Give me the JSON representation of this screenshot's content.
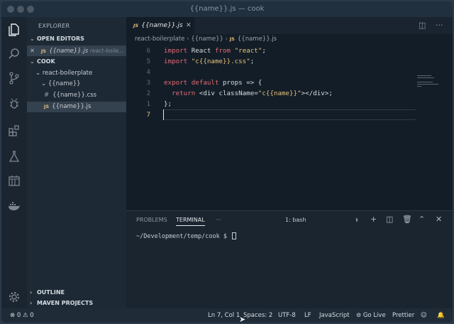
{
  "window": {
    "title": "{{name}}.js — cook"
  },
  "activity_bar": {
    "icons": [
      "files-icon",
      "search-icon",
      "source-control-icon",
      "debug-icon",
      "extensions-icon",
      "flask-icon",
      "calendar-icon",
      "docker-icon",
      "gear-icon"
    ]
  },
  "sidebar": {
    "title": "EXPLORER",
    "open_editors_label": "OPEN EDITORS",
    "open_editor": {
      "name": "{{name}}.js",
      "path": "react-boile...",
      "icon": "JS"
    },
    "folder_label": "COOK",
    "tree": [
      {
        "name": "react-boilerplate"
      },
      {
        "name": "{{name}}"
      },
      {
        "name": "{{name}}.css",
        "icon": "#"
      },
      {
        "name": "{{name}}.js",
        "icon": "JS"
      }
    ],
    "outline_label": "OUTLINE",
    "maven_label": "MAVEN PROJECTS"
  },
  "editor": {
    "tab": {
      "label": "{{name}}.js",
      "icon": "JS"
    },
    "breadcrumb": [
      "react-boilerplate",
      "{{name}}",
      "{{name}}.js"
    ],
    "line_numbers": [
      "6",
      "5",
      "4",
      "3",
      "2",
      "1",
      "7"
    ],
    "lines": [
      {
        "t1": "import",
        "t2": " React ",
        "t3": "from",
        "t4": " ",
        "t5": "\"react\"",
        "t6": ";"
      },
      {
        "t1": "import",
        "t2": " ",
        "t3": "",
        "t4": "",
        "t5": "\"c{{name}}.css\"",
        "t6": ";"
      },
      {
        "t1": "",
        "t2": "",
        "t3": "",
        "t4": "",
        "t5": "",
        "t6": ""
      },
      {
        "t1": "export",
        "t2": " ",
        "t3": "default",
        "t4": " props => {",
        "t5": "",
        "t6": ""
      },
      {
        "t1": "  return",
        "t2": " <div className=",
        "t3": "",
        "t4": "",
        "t5": "\"c{{name}}\"",
        "t6": "></div>;"
      },
      {
        "t1": "",
        "t2": "};",
        "t3": "",
        "t4": "",
        "t5": "",
        "t6": ""
      },
      {
        "t1": "",
        "t2": "",
        "t3": "",
        "t4": "",
        "t5": "",
        "t6": ""
      }
    ]
  },
  "panel": {
    "tabs": [
      "PROBLEMS",
      "TERMINAL",
      "···"
    ],
    "terminal_select": "1: bash",
    "prompt": "~/Development/temp/cook $ "
  },
  "statusbar": {
    "errors": "0",
    "warnings": "0",
    "position": "Ln 7, Col 1",
    "spaces": "Spaces: 2",
    "encoding": "UTF-8",
    "eol": "LF",
    "language": "JavaScript",
    "golive": "Go Live",
    "prettier": "Prettier"
  },
  "colors": {
    "accent_keyword": "#e06c75",
    "string": "#e5c07b",
    "background": "#131d27"
  }
}
